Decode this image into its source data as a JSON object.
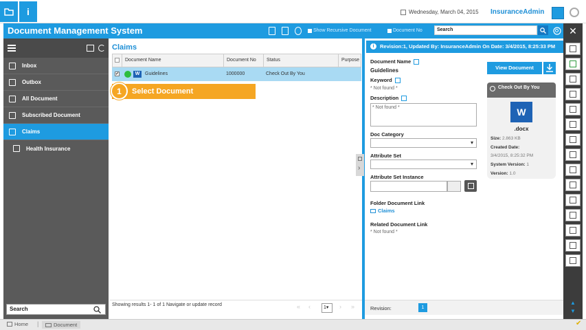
{
  "topbar": {
    "date": "Wednesday, March 04, 2015",
    "username": "InsuranceAdmin",
    "info_glyph": "i"
  },
  "titlebar": {
    "app_title": "Document Management System",
    "show_recursive_label": "Show Recursive Document",
    "document_no_label": "Document No",
    "search_placeholder": "Search"
  },
  "sidebar": {
    "items": [
      {
        "label": "Inbox"
      },
      {
        "label": "Outbox"
      },
      {
        "label": "All Document"
      },
      {
        "label": "Subscribed Document"
      },
      {
        "label": "Claims"
      },
      {
        "label": "Health Insurance"
      }
    ],
    "search_placeholder": "Search"
  },
  "grid": {
    "title": "Claims",
    "columns": [
      "Document Name",
      "Document No",
      "Status",
      "Purpose"
    ],
    "rows": [
      {
        "name": "Guidelines",
        "doc_no": "1000000",
        "status": "Check Out By You",
        "purpose": ""
      }
    ],
    "footer_text": "Showing results 1- 1 of 1 Navigate or update record",
    "page_value": "1"
  },
  "callout": {
    "number": "1",
    "text": "Select Document"
  },
  "detail": {
    "revision_banner": "Revision:1, Updated By: InsuranceAdmin On Date: 3/4/2015, 8:25:33 PM",
    "document_name_label": "Document Name",
    "document_name_value": "Guidelines",
    "keyword_label": "Keyword",
    "keyword_value": "* Not found *",
    "description_label": "Description",
    "description_value": "* Not found *",
    "doc_category_label": "Doc Category",
    "attribute_set_label": "Attribute Set",
    "attribute_set_instance_label": "Attribute Set Instance",
    "folder_link_label": "Folder Document Link",
    "folder_link_value": "Claims",
    "related_link_label": "Related Document Link",
    "related_link_value": "* Not found *",
    "view_document_label": "View Document",
    "checkout_label": "Check Out By You",
    "file": {
      "icon_letter": "W",
      "extension": ".docx",
      "size_label": "Size:",
      "size_value": "2.863 KB",
      "created_label": "Created Date:",
      "created_value": "3/4/2015, 8:25:32 PM",
      "system_version_label": "System Version:",
      "system_version_value": "1",
      "version_label": "Version:",
      "version_value": "1.0"
    },
    "revision_label": "Revision:",
    "revision_page": "1"
  },
  "statusbar": {
    "home": "Home",
    "document": "Document"
  },
  "colors": {
    "primary": "#1e9be0",
    "callout": "#f5a623",
    "sidebar": "#5a5a5a",
    "toolbar": "#3c3c3c"
  }
}
